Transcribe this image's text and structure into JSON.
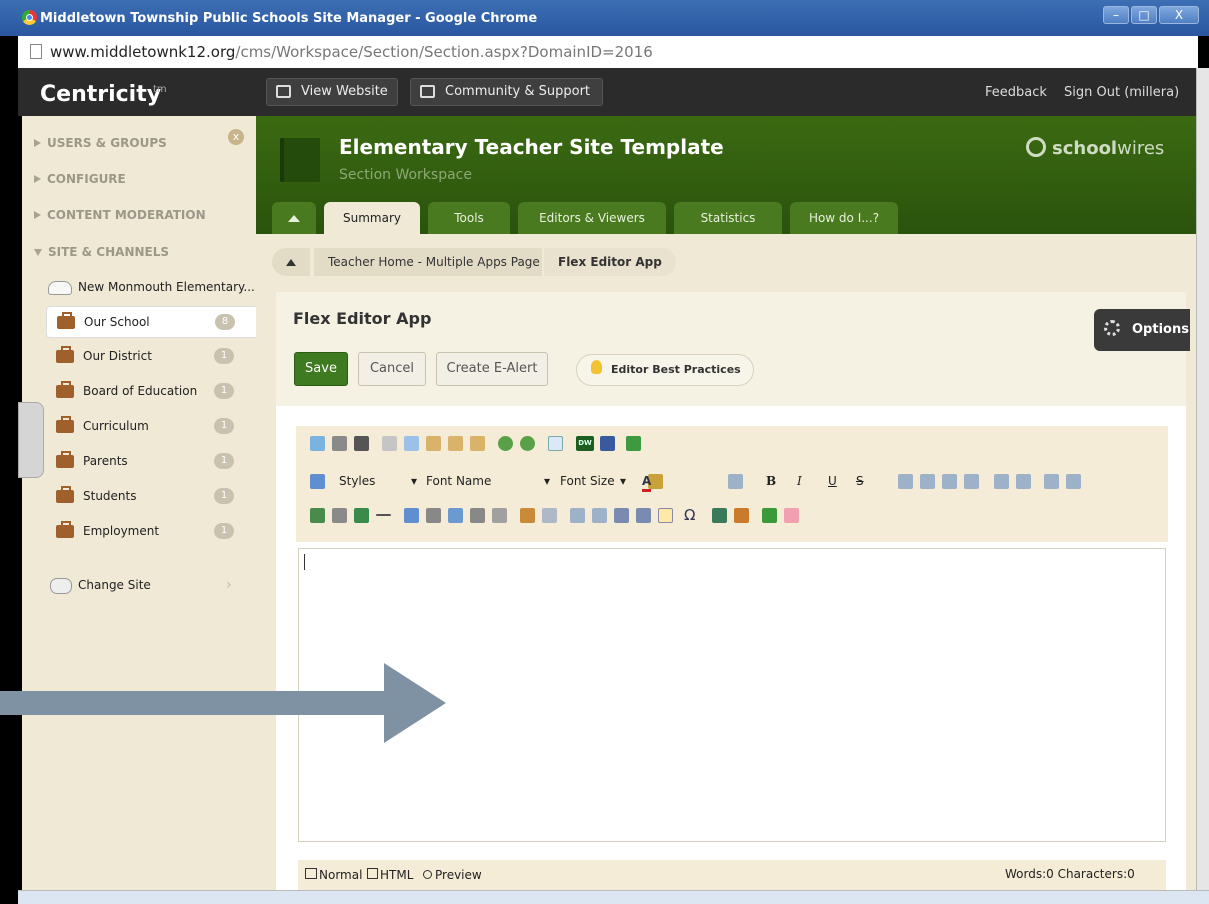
{
  "window": {
    "title": "Middletown Township Public Schools Site Manager - Google Chrome",
    "minimize": "–",
    "maximize": "□",
    "close": "X"
  },
  "address": {
    "host": "www.middletownk12.org",
    "path": "/cms/Workspace/Section/Section.aspx?DomainID=2016"
  },
  "header": {
    "brand": "Centricity",
    "brand_tm": "tm",
    "view_website": "View Website",
    "community_support": "Community & Support",
    "feedback": "Feedback",
    "sign_out": "Sign Out (millera)"
  },
  "sidebar": {
    "sections": [
      "USERS & GROUPS",
      "CONFIGURE",
      "CONTENT MODERATION",
      "SITE & CHANNELS"
    ],
    "close": "x",
    "site_name": "New Monmouth Elementary...",
    "channels": [
      {
        "label": "Our School",
        "count": "8"
      },
      {
        "label": "Our District",
        "count": "1"
      },
      {
        "label": "Board of Education",
        "count": "1"
      },
      {
        "label": "Curriculum",
        "count": "1"
      },
      {
        "label": "Parents",
        "count": "1"
      },
      {
        "label": "Students",
        "count": "1"
      },
      {
        "label": "Employment",
        "count": "1"
      }
    ],
    "change_site": "Change Site",
    "chevron": "›"
  },
  "workspace": {
    "title": "Elementary Teacher Site Template",
    "subtitle": "Section Workspace",
    "logo_bold": "school",
    "logo_light": "wires",
    "tabs": [
      "Summary",
      "Tools",
      "Editors & Viewers",
      "Statistics",
      "How do I...?"
    ]
  },
  "breadcrumb": {
    "items": [
      "Teacher Home - Multiple Apps Page",
      "Flex Editor App"
    ]
  },
  "app": {
    "title": "Flex Editor App",
    "options": "Options",
    "save": "Save",
    "cancel": "Cancel",
    "create_alert": "Create E-Alert",
    "best_practices": "Editor Best Practices"
  },
  "editor": {
    "styles": "Styles",
    "font_name": "Font Name",
    "font_size": "Font Size",
    "modes": [
      "Normal",
      "HTML",
      "Preview"
    ],
    "word_count": "Words:0 Characters:0",
    "text_color": "#cc2222",
    "bold": "B",
    "italic": "I",
    "underline": "U",
    "strike": "S",
    "omega": "Ω",
    "dw": "DW"
  }
}
